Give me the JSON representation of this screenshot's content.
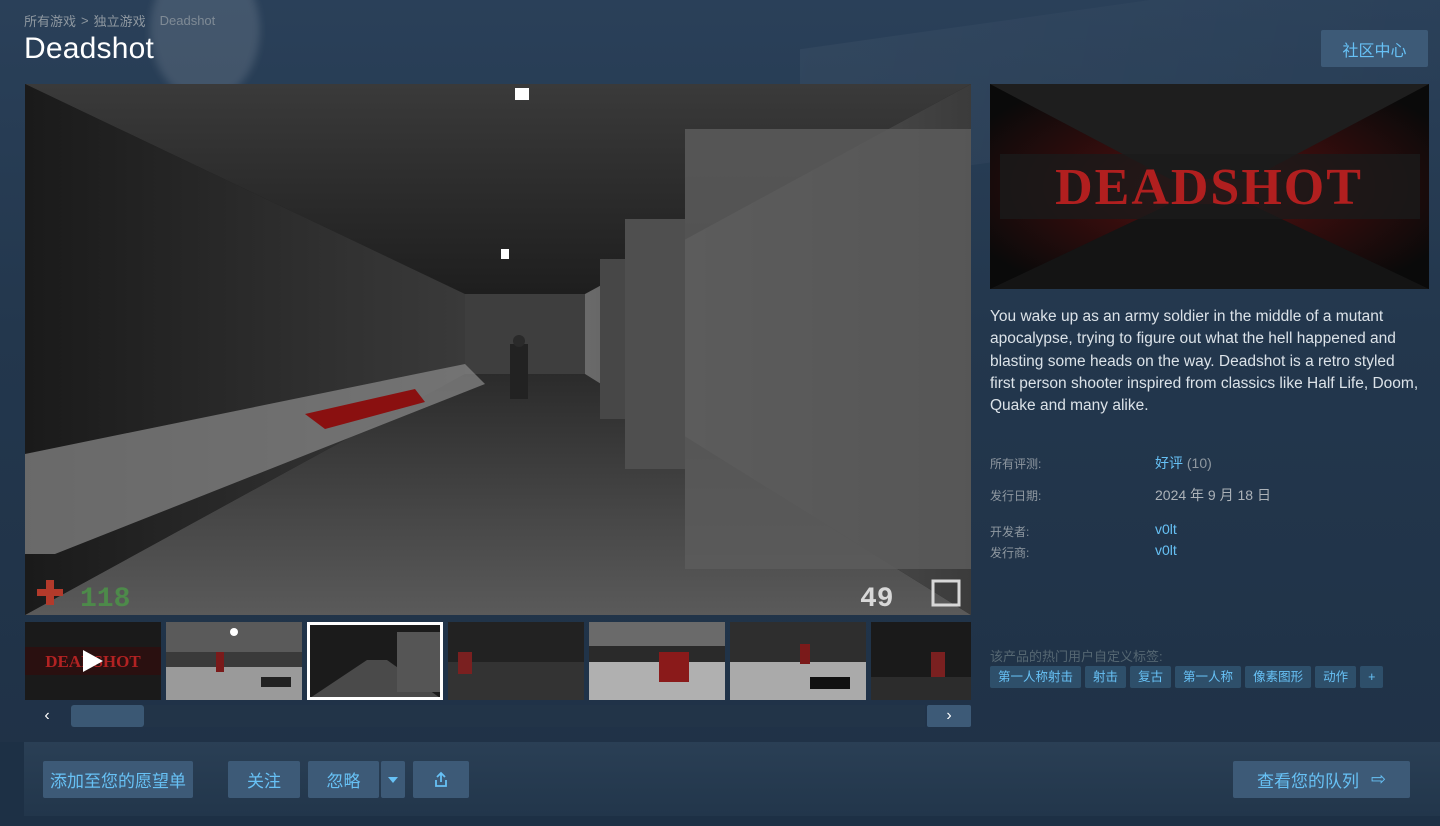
{
  "breadcrumb": {
    "items": [
      "所有游戏",
      "独立游戏"
    ],
    "separator": ">",
    "current": "Deadshot"
  },
  "title": "Deadshot",
  "community_hub": "社区中心",
  "hud": {
    "health": "118",
    "ammo": "49"
  },
  "capsule_logo_text": "DEADSHOT",
  "description": "You wake up as an army soldier in the middle of a mutant apocalypse, trying to figure out what the hell happened and blasting some heads on the way. Deadshot is a retro styled first person shooter inspired from classics like Half Life, Doom, Quake and many alike.",
  "meta": {
    "reviews_label": "所有评测:",
    "reviews_value": "好评",
    "reviews_count": "(10)",
    "release_label": "发行日期:",
    "release_value": "2024 年 9 月 18 日",
    "developer_label": "开发者:",
    "developer_value": "v0lt",
    "publisher_label": "发行商:",
    "publisher_value": "v0lt"
  },
  "tags_title": "该产品的热门用户自定义标签:",
  "tags": [
    "第一人称射击",
    "射击",
    "复古",
    "第一人称",
    "像素图形",
    "动作",
    "+"
  ],
  "thumbnail_logo_text": "DEADSHOT",
  "slider": {
    "left_icon": "‹",
    "right_icon": "›",
    "position": 0.0
  },
  "actions": {
    "wishlist": "添加至您的愿望单",
    "follow": "关注",
    "ignore": "忽略",
    "share_icon": "share-icon",
    "queue": "查看您的队列",
    "queue_icon": "⇨"
  },
  "colors": {
    "accent": "#67c1f5",
    "button_bg": "#3d5a77",
    "page_bg": "#23374d"
  }
}
